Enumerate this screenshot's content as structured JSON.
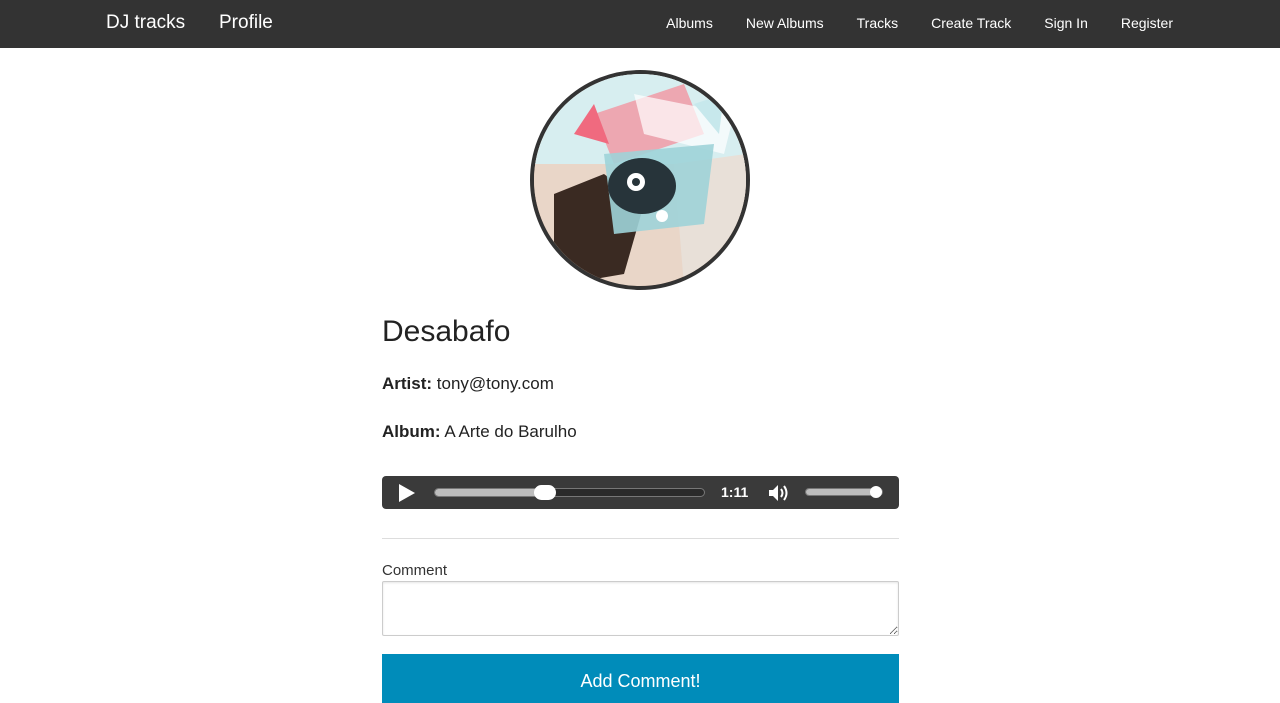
{
  "navbar": {
    "brand": "DJ tracks",
    "profile": "Profile",
    "links": [
      "Albums",
      "New Albums",
      "Tracks",
      "Create Track",
      "Sign In",
      "Register"
    ]
  },
  "track": {
    "title": "Desabafo",
    "artist_label": "Artist:",
    "artist": "tony@tony.com",
    "album_label": "Album:",
    "album": "A Arte do Barulho"
  },
  "player": {
    "time": "1:11",
    "progress": 0.41,
    "volume": 1.0
  },
  "comment_form": {
    "label": "Comment",
    "value": "",
    "submit": "Add Comment!"
  },
  "colors": {
    "navbar": "#333333",
    "player": "#3a3a3a",
    "button": "#008cba"
  }
}
